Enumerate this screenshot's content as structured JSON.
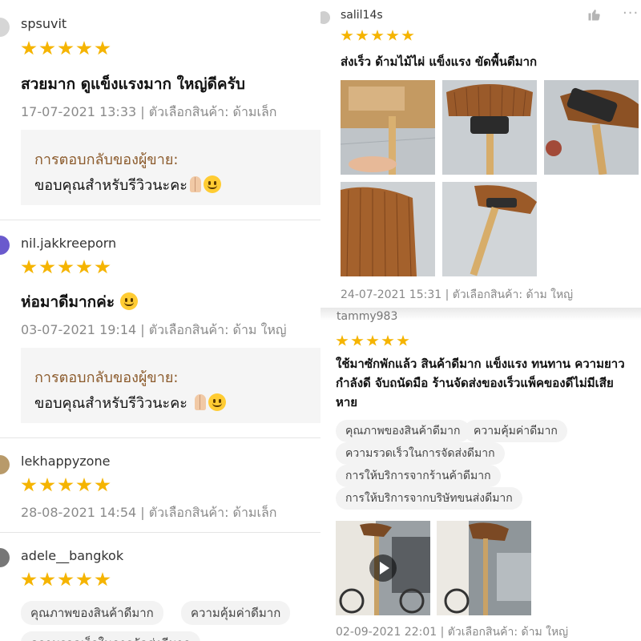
{
  "left_reviews": [
    {
      "username": "spsuvit",
      "comment": "สวยมาก ดูแข็งแรงมาก ใหญ่ดีครับ",
      "meta": "17-07-2021 13:33 | ตัวเลือกสินค้า: ด้ามเล็ก",
      "reply_title": "การตอบกลับของผู้ขาย:",
      "reply_body": "ขอบคุณสำหรับรีวิวนะคะ"
    },
    {
      "username": "nil.jakkreeporn",
      "comment": "ห่อมาดีมากค่ะ",
      "meta": "03-07-2021 19:14 | ตัวเลือกสินค้า: ด้าม ใหญ่",
      "reply_title": "การตอบกลับของผู้ขาย:",
      "reply_body": "ขอบคุณสำหรับรีวิวนะคะ"
    },
    {
      "username": "lekhappyzone",
      "meta": "28-08-2021 14:54 | ตัวเลือกสินค้า: ด้ามเล็ก"
    },
    {
      "username": "adele__bangkok",
      "tags": [
        "คุณภาพของสินค้าดีมาก",
        "ความคุ้มค่าดีมาก",
        "ความรวดเร็วในการจัดส่งดีมาก"
      ]
    }
  ],
  "right_reviews": [
    {
      "username": "salil14s",
      "comment": "ส่งเร็ว ด้ามไม้ไผ่ แข็งแรง ขัดพื้นดีมาก",
      "meta": "24-07-2021 15:31 | ตัวเลือกสินค้า: ด้าม ใหญ่"
    },
    {
      "username": "tammy983",
      "comment_lines": [
        "ใช้มาซักพักแล้ว สินค้าดีมาก แข็งแรง ทนทาน ความยาว",
        "กำลังดี จับถนัดมือ ร้านจัดส่งของเร็วแพ็คของดีไม่มีเสีย",
        "หาย"
      ],
      "tags": [
        "คุณภาพของสินค้าดีมาก",
        "ความคุ้มค่าดีมาก",
        "ความรวดเร็วในการจัดส่งดีมาก",
        "การให้บริการจากร้านค้าดีมาก",
        "การให้บริการจากบริษัทขนส่งดีมาก"
      ],
      "meta": "02-09-2021 22:01 | ตัวเลือกสินค้า: ด้าม ใหญ่"
    }
  ],
  "rating": 5,
  "icons": {
    "like": "thumbs-up-icon",
    "more": "more-options-icon",
    "play": "play-icon",
    "star": "star-icon"
  },
  "colors": {
    "star": "#f5b400",
    "reply_title": "#8b5a2b",
    "meta": "#8a8a8a",
    "reply_bg": "#f5f5f5"
  }
}
